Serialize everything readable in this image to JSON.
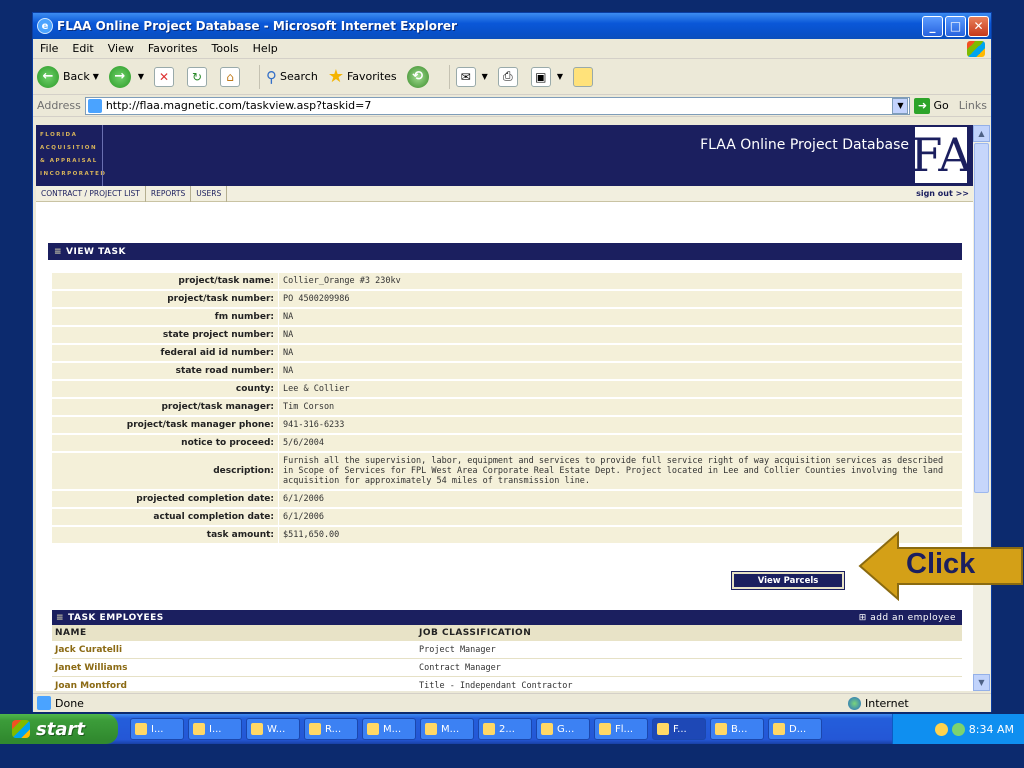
{
  "window": {
    "title": "FLAA Online Project Database - Microsoft Internet Explorer"
  },
  "menu": [
    "File",
    "Edit",
    "View",
    "Favorites",
    "Tools",
    "Help"
  ],
  "toolbar": {
    "back": "Back",
    "search": "Search",
    "favorites": "Favorites"
  },
  "address": {
    "label": "Address",
    "url": "http://flaa.magnetic.com/taskview.asp?taskid=7",
    "go": "Go",
    "links": "Links"
  },
  "site": {
    "logo_lines": [
      "FLORIDA",
      "ACQUISITION",
      "& APPRAISAL",
      "INCORPORATED"
    ],
    "title": "FLAA Online Project Database",
    "monogram": "FA"
  },
  "nav": {
    "items": [
      "CONTRACT / PROJECT LIST",
      "REPORTS",
      "USERS"
    ],
    "signout": "sign out >>"
  },
  "view_task": {
    "heading": "VIEW TASK",
    "fields": [
      {
        "label": "project/task name:",
        "value": "Collier_Orange #3 230kv"
      },
      {
        "label": "project/task number:",
        "value": "PO 4500209986"
      },
      {
        "label": "fm number:",
        "value": "NA"
      },
      {
        "label": "state project number:",
        "value": "NA"
      },
      {
        "label": "federal aid id number:",
        "value": "NA"
      },
      {
        "label": "state road number:",
        "value": "NA"
      },
      {
        "label": "county:",
        "value": "Lee & Collier"
      },
      {
        "label": "project/task manager:",
        "value": "Tim Corson"
      },
      {
        "label": "project/task manager phone:",
        "value": "941-316-6233"
      },
      {
        "label": "notice to proceed:",
        "value": "5/6/2004"
      },
      {
        "label": "description:",
        "value": "Furnish all the supervision, labor, equipment and services to provide full service right of way acquisition services as described in Scope of Services for FPL West Area Corporate Real Estate Dept. Project located in Lee and Collier Counties involving the land acquisition for approximately 54 miles of transmission line."
      },
      {
        "label": "projected completion date:",
        "value": "6/1/2006"
      },
      {
        "label": "actual completion date:",
        "value": "6/1/2006"
      },
      {
        "label": "task amount:",
        "value": "$511,650.00"
      }
    ],
    "view_parcels": "View Parcels"
  },
  "callout": {
    "text": "Click"
  },
  "employees": {
    "heading": "TASK EMPLOYEES",
    "add_label": "add an employee",
    "col_name": "NAME",
    "col_job": "JOB CLASSIFICATION",
    "rows": [
      {
        "name": "Jack Curatelli",
        "job": "Project Manager"
      },
      {
        "name": "Janet Williams",
        "job": "Contract Manager"
      },
      {
        "name": "Joan Montford",
        "job": "Title - Independant Contractor"
      }
    ]
  },
  "status": {
    "left": "Done",
    "zone": "Internet"
  },
  "taskbar": {
    "start": "start",
    "tasks": [
      "I...",
      "I...",
      "W...",
      "R...",
      "M...",
      "M...",
      "2...",
      "G...",
      "Fl...",
      "F...",
      "B...",
      "D..."
    ],
    "active_index": 9,
    "clock": "8:34 AM"
  }
}
